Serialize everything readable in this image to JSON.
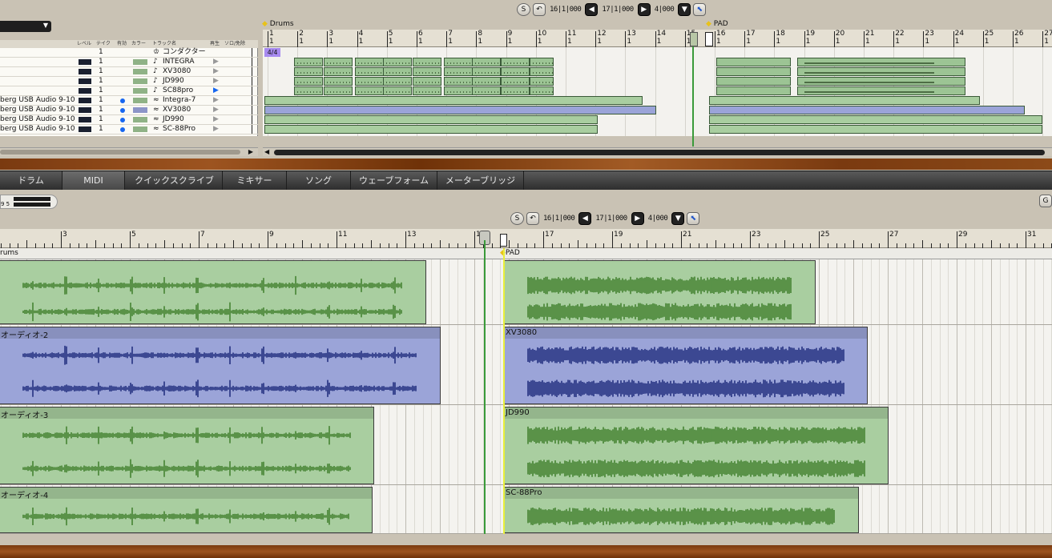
{
  "colors": {
    "green_clip": "#a9cea0",
    "green_wave": "#3f7f2a",
    "blue_clip": "#9ba4d8",
    "blue_wave": "#1d2a7a",
    "midi_clip": "#9cc494",
    "purple_marker": "#a78af0",
    "tab_bg": "#3b3b3b",
    "cursor_yellow": "#e9ef3a",
    "cursor_green": "#3a9a3a"
  },
  "transport_top": {
    "solo_label": "S",
    "loop_start": "16|1|000",
    "loop_end": "17|1|000",
    "length": "4|000"
  },
  "transport_bottom": {
    "solo_label": "S",
    "loop_start": "16|1|000",
    "loop_end": "17|1|000",
    "length": "4|000",
    "g_label": "G"
  },
  "markers_top": {
    "drums": "Drums",
    "pad": "PAD",
    "timesig": "4/4"
  },
  "ruler_top": {
    "bars": [
      "1",
      "2",
      "3",
      "4",
      "5",
      "6",
      "7",
      "8",
      "9",
      "10",
      "11",
      "12",
      "13",
      "14",
      "15",
      "16",
      "17",
      "18",
      "19",
      "20",
      "21",
      "22",
      "23",
      "24",
      "25",
      "26",
      "27"
    ],
    "beat": "1"
  },
  "ruler_bottom": {
    "bars": [
      "3",
      "5",
      "7",
      "9",
      "11",
      "13",
      "15",
      "17",
      "19",
      "21",
      "23",
      "25",
      "27",
      "29",
      "31"
    ]
  },
  "track_list": {
    "headers": [
      "レベル",
      "テイク",
      "有効",
      "カラー",
      "トラック名",
      "再生",
      "ソロ/免除"
    ],
    "rows": [
      {
        "input": "",
        "take": "1",
        "name": "コンダクター",
        "icon": "conductor-icon",
        "color": "",
        "active": false,
        "play": ""
      },
      {
        "input": "",
        "take": "1",
        "name": "INTEGRA",
        "icon": "midi-note-icon",
        "color": "#8fb286",
        "active": false,
        "play": "▶"
      },
      {
        "input": "",
        "take": "1",
        "name": "XV3080",
        "icon": "midi-note-icon",
        "color": "#8fb286",
        "active": false,
        "play": "▶"
      },
      {
        "input": "",
        "take": "1",
        "name": "JD990",
        "icon": "midi-note-icon",
        "color": "#8fb286",
        "active": false,
        "play": "▶"
      },
      {
        "input": "",
        "take": "1",
        "name": "SC88pro",
        "icon": "midi-note-icon",
        "color": "#8fb286",
        "active": false,
        "play": "▶"
      },
      {
        "input": "berg USB Audio 9-10",
        "take": "1",
        "name": "Integra-7",
        "icon": "audio-wave-icon",
        "color": "#8fb286",
        "active": true,
        "play": "▶"
      },
      {
        "input": "berg USB Audio 9-10",
        "take": "1",
        "name": "XV3080",
        "icon": "audio-wave-icon",
        "color": "#8c95c8",
        "active": true,
        "play": "▶"
      },
      {
        "input": "berg USB Audio 9-10",
        "take": "1",
        "name": "JD990",
        "icon": "audio-wave-icon",
        "color": "#8fb286",
        "active": true,
        "play": "▶"
      },
      {
        "input": "berg USB Audio 9-10",
        "take": "1",
        "name": "SC-88Pro",
        "icon": "audio-wave-icon",
        "color": "#8fb286",
        "active": true,
        "play": "▶"
      }
    ]
  },
  "tabs": [
    "ドラム",
    "MIDI",
    "クイックスクライブ",
    "ミキサー",
    "ソング",
    "ウェーブフォーム",
    "メーターブリッジ"
  ],
  "active_tab": "MIDI",
  "lower_meter": "9 5",
  "wave_lanes": [
    {
      "left_label": "rums",
      "right_label": "PAD",
      "color": "green"
    },
    {
      "left_label": "オーディオ-2",
      "right_label": "XV3080",
      "color": "blue"
    },
    {
      "left_label": "オーディオ-3",
      "right_label": "JD990",
      "color": "green"
    },
    {
      "left_label": "オーディオ-4",
      "right_label": "SC-88Pro",
      "color": "green"
    }
  ]
}
